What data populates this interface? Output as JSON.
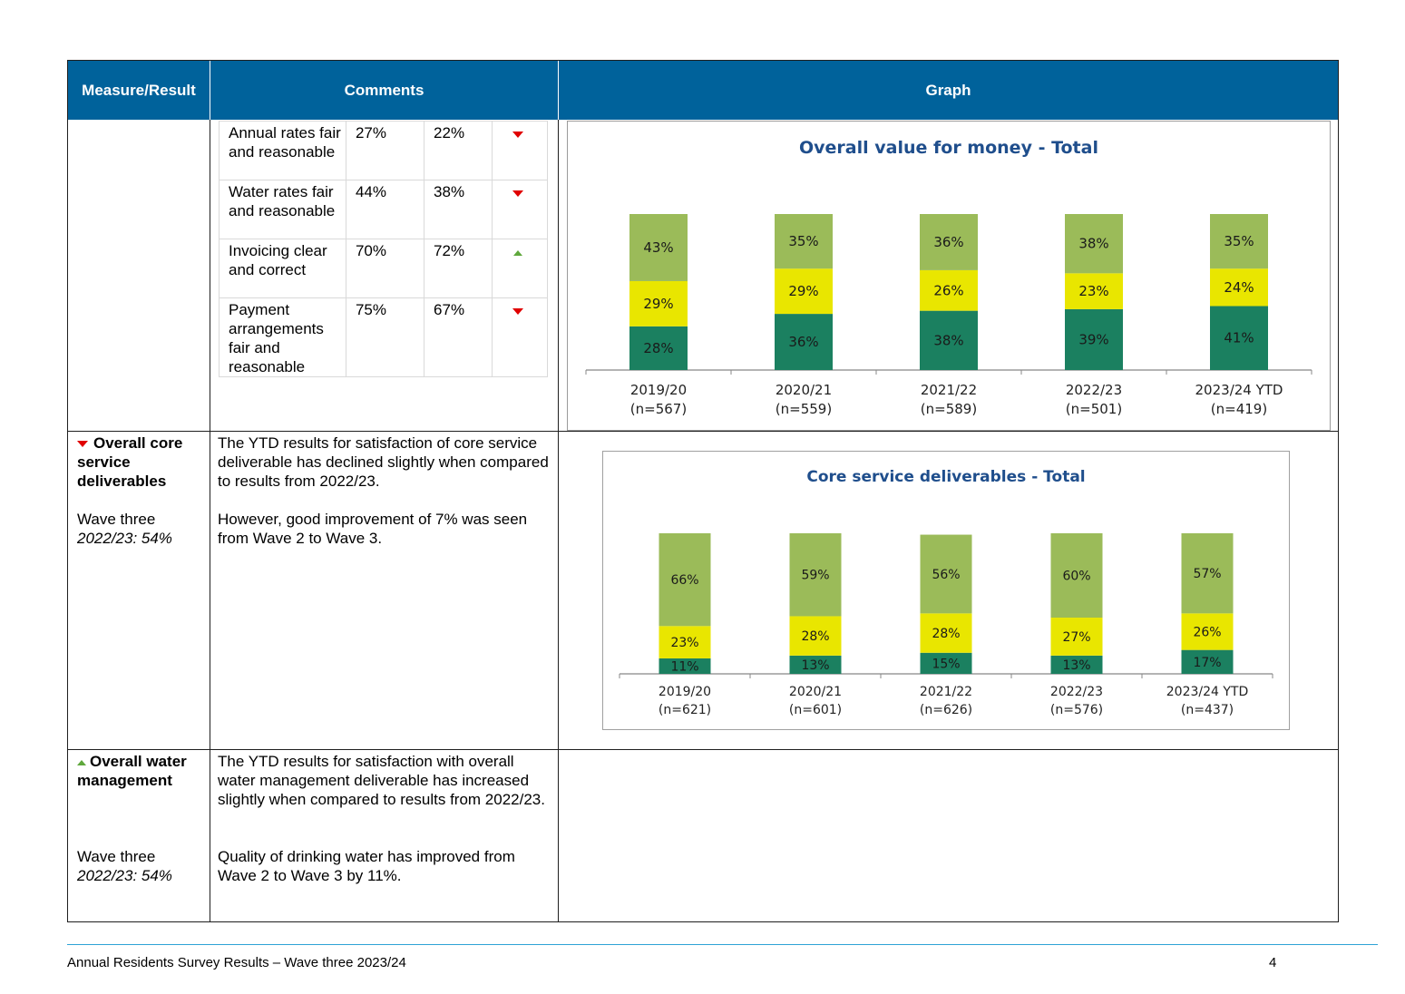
{
  "header": {
    "col1": "Measure/Result",
    "col2": "Comments",
    "col3": "Graph"
  },
  "row1": {
    "subtable": [
      {
        "label": "Annual rates fair and reasonable",
        "a": "27%",
        "b": "22%",
        "trend": "down"
      },
      {
        "label": "Water rates fair and reasonable",
        "a": "44%",
        "b": "38%",
        "trend": "down"
      },
      {
        "label": "Invoicing clear and correct",
        "a": "70%",
        "b": "72%",
        "trend": "up"
      },
      {
        "label": "Payment arrangements fair and reasonable",
        "a": "75%",
        "b": "67%",
        "trend": "down"
      }
    ]
  },
  "row2": {
    "measure_title": "Overall core service deliverables",
    "wave": "Wave three",
    "prior": "2022/23: 54%",
    "comment1": "The YTD results for satisfaction of core service deliverable has declined slightly when compared to results from 2022/23.",
    "comment2": "However, good improvement of 7% was seen from Wave 2 to Wave 3."
  },
  "row3": {
    "measure_title": "Overall water management",
    "wave": "Wave three",
    "prior": "2022/23: 54%",
    "comment1": "The YTD results for satisfaction with overall water management deliverable has increased slightly when compared to results from 2022/23.",
    "comment2": "Quality of drinking water has improved from Wave 2 to Wave 3 by 11%."
  },
  "footer": {
    "left": "Annual Residents Survey Results – Wave three 2023/24",
    "page": "4"
  },
  "colors": {
    "header_bg": "#00629b",
    "dark_green": "#1b8060",
    "yellow": "#e9e600",
    "light_green": "#9bbb59",
    "title_blue": "#1f4e8c"
  },
  "chart_data": [
    {
      "type": "bar",
      "stacked": true,
      "title": "Overall value for money - Total",
      "categories": [
        "2019/20\n(n=567)",
        "2020/21\n(n=559)",
        "2021/22\n(n=589)",
        "2022/23\n(n=501)",
        "2023/24 YTD\n(n=419)"
      ],
      "series": [
        {
          "color": "#1b8060",
          "values": [
            28,
            36,
            38,
            39,
            41
          ]
        },
        {
          "color": "#e9e600",
          "values": [
            29,
            29,
            26,
            23,
            24
          ]
        },
        {
          "color": "#9bbb59",
          "values": [
            43,
            35,
            36,
            38,
            35
          ]
        }
      ],
      "data_labels": "percent",
      "legend": "none"
    },
    {
      "type": "bar",
      "stacked": true,
      "title": "Core service deliverables - Total",
      "categories": [
        "2019/20\n(n=621)",
        "2020/21\n(n=601)",
        "2021/22\n(n=626)",
        "2022/23\n(n=576)",
        "2023/24 YTD\n(n=437)"
      ],
      "series": [
        {
          "color": "#1b8060",
          "values": [
            11,
            13,
            15,
            13,
            17
          ]
        },
        {
          "color": "#e9e600",
          "values": [
            23,
            28,
            28,
            27,
            26
          ]
        },
        {
          "color": "#9bbb59",
          "values": [
            66,
            59,
            56,
            60,
            57
          ]
        }
      ],
      "data_labels": "percent",
      "legend": "none"
    }
  ]
}
